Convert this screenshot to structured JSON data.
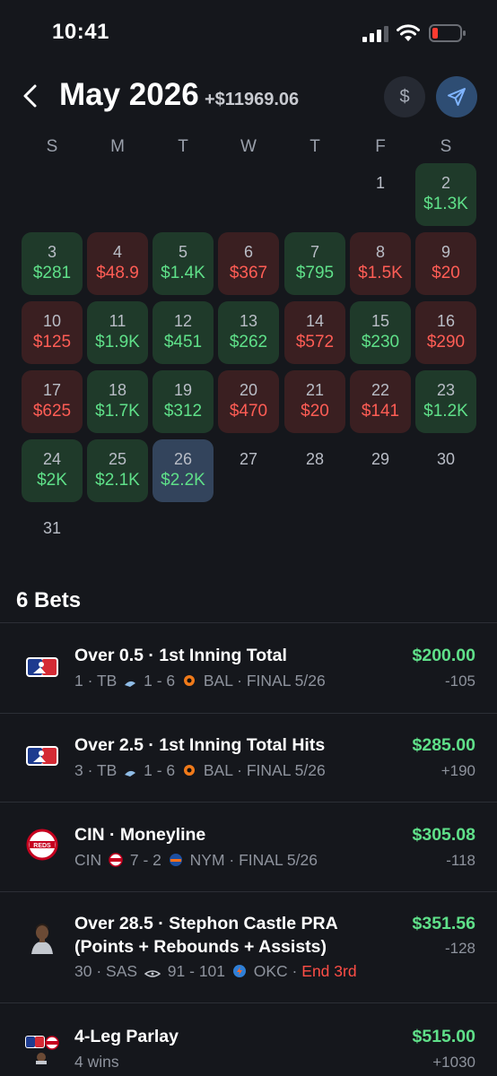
{
  "status_bar": {
    "time": "10:41"
  },
  "header": {
    "month": "May 2026",
    "total": "+$11969.06",
    "dollar_label": "$"
  },
  "calendar": {
    "weekdays": [
      "S",
      "M",
      "T",
      "W",
      "T",
      "F",
      "S"
    ],
    "days": [
      {
        "day": "1",
        "amount": "",
        "type": "empty"
      },
      {
        "day": "2",
        "amount": "$1.3K",
        "type": "win"
      },
      {
        "day": "3",
        "amount": "$281",
        "type": "win"
      },
      {
        "day": "4",
        "amount": "$48.9",
        "type": "loss"
      },
      {
        "day": "5",
        "amount": "$1.4K",
        "type": "win"
      },
      {
        "day": "6",
        "amount": "$367",
        "type": "loss"
      },
      {
        "day": "7",
        "amount": "$795",
        "type": "win"
      },
      {
        "day": "8",
        "amount": "$1.5K",
        "type": "loss"
      },
      {
        "day": "9",
        "amount": "$20",
        "type": "loss"
      },
      {
        "day": "10",
        "amount": "$125",
        "type": "loss"
      },
      {
        "day": "11",
        "amount": "$1.9K",
        "type": "win"
      },
      {
        "day": "12",
        "amount": "$451",
        "type": "win"
      },
      {
        "day": "13",
        "amount": "$262",
        "type": "win"
      },
      {
        "day": "14",
        "amount": "$572",
        "type": "loss"
      },
      {
        "day": "15",
        "amount": "$230",
        "type": "win"
      },
      {
        "day": "16",
        "amount": "$290",
        "type": "loss"
      },
      {
        "day": "17",
        "amount": "$625",
        "type": "loss"
      },
      {
        "day": "18",
        "amount": "$1.7K",
        "type": "win"
      },
      {
        "day": "19",
        "amount": "$312",
        "type": "win"
      },
      {
        "day": "20",
        "amount": "$470",
        "type": "loss"
      },
      {
        "day": "21",
        "amount": "$20",
        "type": "loss"
      },
      {
        "day": "22",
        "amount": "$141",
        "type": "loss"
      },
      {
        "day": "23",
        "amount": "$1.2K",
        "type": "win"
      },
      {
        "day": "24",
        "amount": "$2K",
        "type": "win"
      },
      {
        "day": "25",
        "amount": "$2.1K",
        "type": "win"
      },
      {
        "day": "26",
        "amount": "$2.2K",
        "type": "today"
      },
      {
        "day": "27",
        "amount": "",
        "type": "empty"
      },
      {
        "day": "28",
        "amount": "",
        "type": "empty"
      },
      {
        "day": "29",
        "amount": "",
        "type": "empty"
      },
      {
        "day": "30",
        "amount": "",
        "type": "empty"
      },
      {
        "day": "31",
        "amount": "",
        "type": "empty"
      }
    ],
    "colors": {
      "win_bg": "#1f3a2a",
      "win_text": "#5fe089",
      "loss_bg": "#3a1f21",
      "loss_text": "#ff5d55",
      "today_bg": "#33445c"
    }
  },
  "bets": {
    "heading": "6 Bets",
    "items": [
      {
        "logo": "mlb-logo-icon",
        "title": "Over 0.5 · 1st Inning Total",
        "sub_pre": "1 · TB",
        "sub_score": "1 - 6",
        "sub_post": "BAL · FINAL 5/26",
        "amount": "$200.00",
        "odds": "-105"
      },
      {
        "logo": "mlb-logo-icon",
        "title": "Over 2.5 · 1st Inning Total Hits",
        "sub_pre": "3 · TB",
        "sub_score": "1 - 6",
        "sub_post": "BAL · FINAL 5/26",
        "amount": "$285.00",
        "odds": "+190"
      },
      {
        "logo": "reds-logo-icon",
        "title": "CIN · Moneyline",
        "sub_pre": "CIN",
        "sub_score": "7 - 2",
        "sub_post": "NYM · FINAL 5/26",
        "amount": "$305.08",
        "odds": "-118"
      },
      {
        "logo": "player-headshot-icon",
        "title": "Over 28.5 · Stephon Castle PRA",
        "title2": "(Points + Rebounds + Assists)",
        "sub_pre": "30 · SAS",
        "sub_score": "91 - 101",
        "sub_post": "OKC ·",
        "sub_live": "End 3rd",
        "amount": "$351.56",
        "odds": "-128"
      },
      {
        "logo": "parlay-logos-icon",
        "title": "4-Leg Parlay",
        "sub_pre": "4 wins",
        "amount": "$515.00",
        "odds": "+1030"
      }
    ]
  }
}
